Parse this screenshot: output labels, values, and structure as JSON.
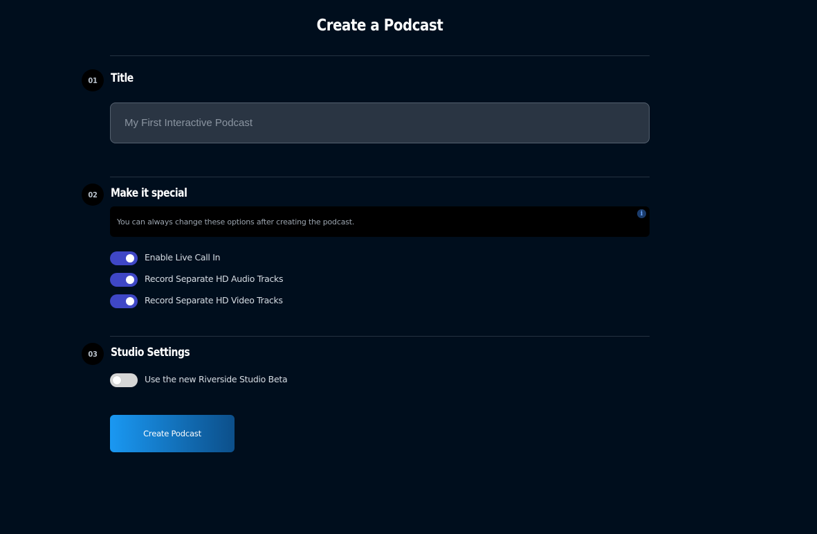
{
  "header": {
    "title": "Create a Podcast"
  },
  "sections": {
    "title": {
      "number": "01",
      "heading": "Title",
      "input_placeholder": "My First Interactive Podcast",
      "input_value": ""
    },
    "special": {
      "number": "02",
      "heading": "Make it special",
      "info_text": "You can always change these options after creating the podcast.",
      "info_icon": "info-icon",
      "toggles": [
        {
          "label": "Enable Live Call In",
          "on": true
        },
        {
          "label": "Record Separate HD Audio Tracks",
          "on": true
        },
        {
          "label": "Record Separate HD Video Tracks",
          "on": true
        }
      ]
    },
    "studio": {
      "number": "03",
      "heading": "Studio Settings",
      "toggles": [
        {
          "label": "Use the new Riverside Studio Beta",
          "on": false
        }
      ]
    }
  },
  "actions": {
    "create_label": "Create Podcast"
  },
  "colors": {
    "background": "#000e1d",
    "toggle_on": "#3f47c6",
    "toggle_off": "#d6d6d6",
    "button_gradient_start": "#1a98f2",
    "button_gradient_end": "#0c4f8a"
  }
}
